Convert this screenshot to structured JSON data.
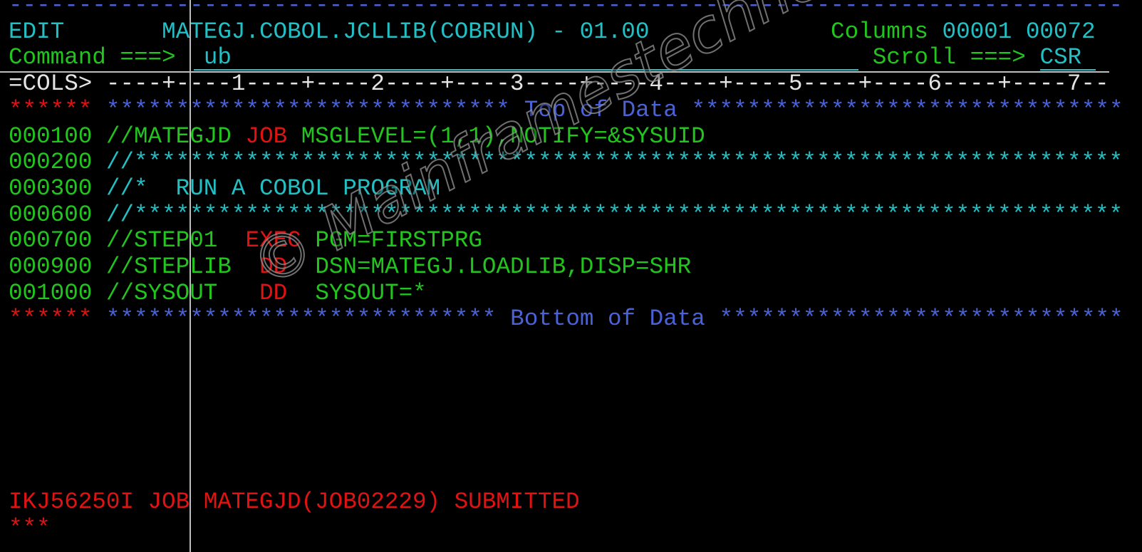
{
  "header": {
    "separator": "--------------------------------------------------------------------------------",
    "mode": "EDIT",
    "dataset": "MATEGJ.COBOL.JCLLIB(COBRUN) - 01.00",
    "columns_label": "Columns",
    "columns_value": "00001 00072",
    "command_label": "Command ===>",
    "command_value": "ub",
    "scroll_label": "Scroll ===>",
    "scroll_value": "CSR"
  },
  "ruler": {
    "label": "=COLS>",
    "scale": "----+----1----+----2----+----3----+----4----+----5----+----6----+----7--"
  },
  "top_marker": {
    "prefix": "******",
    "left": "*****************************",
    "text": "Top of Data",
    "right": "*******************************"
  },
  "lines": [
    {
      "num": "000100",
      "a": "//MATEGJD",
      "kw": "JOB",
      "b": "MSGLEVEL=(1,1),NOTIFY=&SYSUID"
    },
    {
      "num": "000200",
      "a": "//***********************************************************************"
    },
    {
      "num": "000300",
      "a": "//*  RUN A COBOL PROGRAM"
    },
    {
      "num": "000600",
      "a": "//***********************************************************************"
    },
    {
      "num": "000700",
      "a": "//STEP01",
      "kw": "EXEC",
      "b": "PGM=FIRSTPRG"
    },
    {
      "num": "000900",
      "a": "//STEPLIB",
      "kw": "DD",
      "b": "DSN=MATEGJ.LOADLIB,DISP=SHR"
    },
    {
      "num": "001000",
      "a": "//SYSOUT",
      "kw": "DD",
      "b": "SYSOUT=*"
    }
  ],
  "bottom_marker": {
    "prefix": "******",
    "left": "****************************",
    "text": "Bottom of Data",
    "right": "*****************************"
  },
  "message": "IKJ56250I JOB MATEGJD(JOB02229) SUBMITTED",
  "message_marker": "***",
  "watermark": "© Mainframestechhelp",
  "colors": {
    "green": "#22c41e",
    "cyan": "#22bfc4",
    "blue": "#4a62d6",
    "red": "#e01212",
    "white": "#e4e4e4",
    "background": "#000000"
  }
}
